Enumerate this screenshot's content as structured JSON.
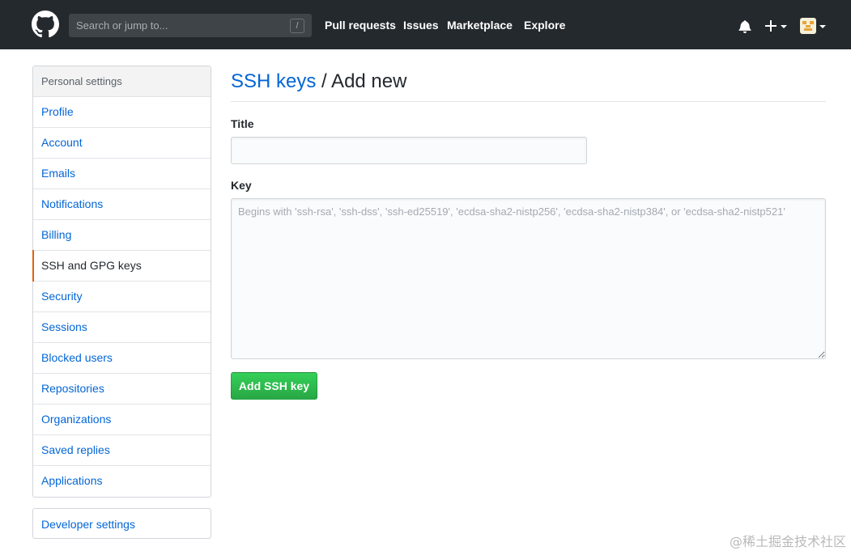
{
  "header": {
    "search_placeholder": "Search or jump to...",
    "search_shortcut": "/",
    "nav": [
      "Pull requests",
      "Issues",
      "Marketplace",
      "Explore"
    ]
  },
  "sidebar": {
    "heading": "Personal settings",
    "items": [
      {
        "label": "Profile"
      },
      {
        "label": "Account"
      },
      {
        "label": "Emails"
      },
      {
        "label": "Notifications"
      },
      {
        "label": "Billing"
      },
      {
        "label": "SSH and GPG keys",
        "selected": true
      },
      {
        "label": "Security"
      },
      {
        "label": "Sessions"
      },
      {
        "label": "Blocked users"
      },
      {
        "label": "Repositories"
      },
      {
        "label": "Organizations"
      },
      {
        "label": "Saved replies"
      },
      {
        "label": "Applications"
      }
    ],
    "developer_settings": "Developer settings"
  },
  "main": {
    "title_link": "SSH keys",
    "title_rest": " / Add new",
    "title_label": "Title",
    "title_value": "",
    "key_label": "Key",
    "key_placeholder": "Begins with 'ssh-rsa', 'ssh-dss', 'ssh-ed25519', 'ecdsa-sha2-nistp256', 'ecdsa-sha2-nistp384', or 'ecdsa-sha2-nistp521'",
    "submit_label": "Add SSH key"
  },
  "watermark": "@稀土掘金技术社区",
  "colors": {
    "header_bg": "#24292e",
    "link": "#0366d6",
    "selected_accent": "#e36209",
    "button_green": "#28a745"
  },
  "icons": [
    "github-logo-icon",
    "bell-icon",
    "plus-icon",
    "avatar",
    "chevron-down-icon"
  ]
}
